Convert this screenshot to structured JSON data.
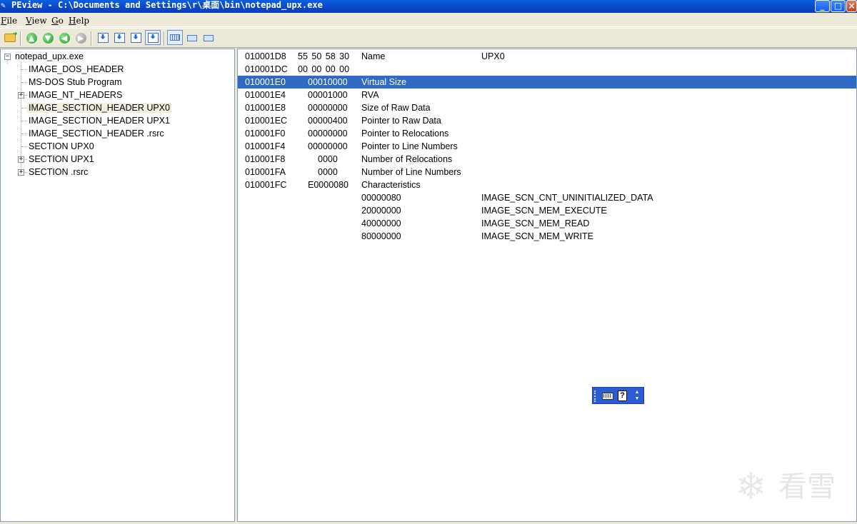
{
  "window": {
    "icon": "wrench-icon",
    "title": "PEview - C:\\Documents and Settings\\r\\桌面\\bin\\notepad_upx.exe",
    "minimize_glyph": "_",
    "maximize_glyph": "□",
    "close_glyph": "×",
    "titlebar_color": "#0b46c6"
  },
  "menu": {
    "file": {
      "accel": "F",
      "rest": "ile"
    },
    "view": {
      "accel": "V",
      "rest": "iew"
    },
    "go": {
      "accel": "G",
      "rest": "o"
    },
    "help": {
      "accel": "H",
      "rest": "elp"
    }
  },
  "toolbar": {
    "icons": [
      "open-file-icon",
      "up-arrow-icon",
      "down-arrow-icon",
      "back-arrow-icon",
      "forward-arrow-icon",
      "save-down-icon",
      "export-icon",
      "next-down-icon",
      "download-icon",
      "view-bytes-icon",
      "view-word-icon",
      "view-dword-icon"
    ],
    "up_glyph": "▲",
    "down_glyph": "▼",
    "back_glyph": "◀",
    "forward_glyph": "▶"
  },
  "tree": {
    "root": "notepad_upx.exe",
    "items": [
      {
        "label": "IMAGE_DOS_HEADER"
      },
      {
        "label": "MS-DOS Stub Program"
      },
      {
        "label": "IMAGE_NT_HEADERS",
        "expander": "+"
      },
      {
        "label": "IMAGE_SECTION_HEADER UPX0",
        "selected": true
      },
      {
        "label": "IMAGE_SECTION_HEADER UPX1"
      },
      {
        "label": "IMAGE_SECTION_HEADER .rsrc"
      },
      {
        "label": "SECTION UPX0"
      },
      {
        "label": "SECTION UPX1",
        "expander": "+"
      },
      {
        "label": "SECTION .rsrc",
        "expander": "+"
      }
    ],
    "root_expander": "−"
  },
  "data_rows": [
    {
      "offset": "010001D8",
      "data": "55  50  58  30",
      "description": "Name",
      "value": "UPX0"
    },
    {
      "offset": "010001DC",
      "data": "00  00  00  00",
      "description": "",
      "value": ""
    },
    {
      "offset": "010001E0",
      "data": "00010000",
      "description": "Virtual Size",
      "value": "",
      "selected": true
    },
    {
      "offset": "010001E4",
      "data": "00001000",
      "description": "RVA",
      "value": ""
    },
    {
      "offset": "010001E8",
      "data": "00000000",
      "description": "Size of Raw Data",
      "value": ""
    },
    {
      "offset": "010001EC",
      "data": "00000400",
      "description": "Pointer to Raw Data",
      "value": ""
    },
    {
      "offset": "010001F0",
      "data": "00000000",
      "description": "Pointer to Relocations",
      "value": ""
    },
    {
      "offset": "010001F4",
      "data": "00000000",
      "description": "Pointer to Line Numbers",
      "value": ""
    },
    {
      "offset": "010001F8",
      "data": "0000",
      "description": "Number of Relocations",
      "value": ""
    },
    {
      "offset": "010001FA",
      "data": "0000",
      "description": "Number of Line Numbers",
      "value": ""
    },
    {
      "offset": "010001FC",
      "data": "E0000080",
      "description": "Characteristics",
      "value": ""
    },
    {
      "offset": "",
      "data": "",
      "description": "00000080",
      "value": "IMAGE_SCN_CNT_UNINITIALIZED_DATA"
    },
    {
      "offset": "",
      "data": "",
      "description": "20000000",
      "value": "IMAGE_SCN_MEM_EXECUTE"
    },
    {
      "offset": "",
      "data": "",
      "description": "40000000",
      "value": "IMAGE_SCN_MEM_READ"
    },
    {
      "offset": "",
      "data": "",
      "description": "80000000",
      "value": "IMAGE_SCN_MEM_WRITE"
    }
  ],
  "ime_toolbar": {
    "icons": [
      "keyboard-icon",
      "help-icon",
      "options-arrow-icon"
    ],
    "help_glyph": "?",
    "arrow_glyph": "▲\n▼"
  },
  "watermark": {
    "icon": "snowflake-icon",
    "glyph": "❄",
    "text": "看雪"
  },
  "colors": {
    "selection": "#316ac5",
    "tree_selection": "#f3efe0",
    "chrome": "#ece9d8"
  }
}
